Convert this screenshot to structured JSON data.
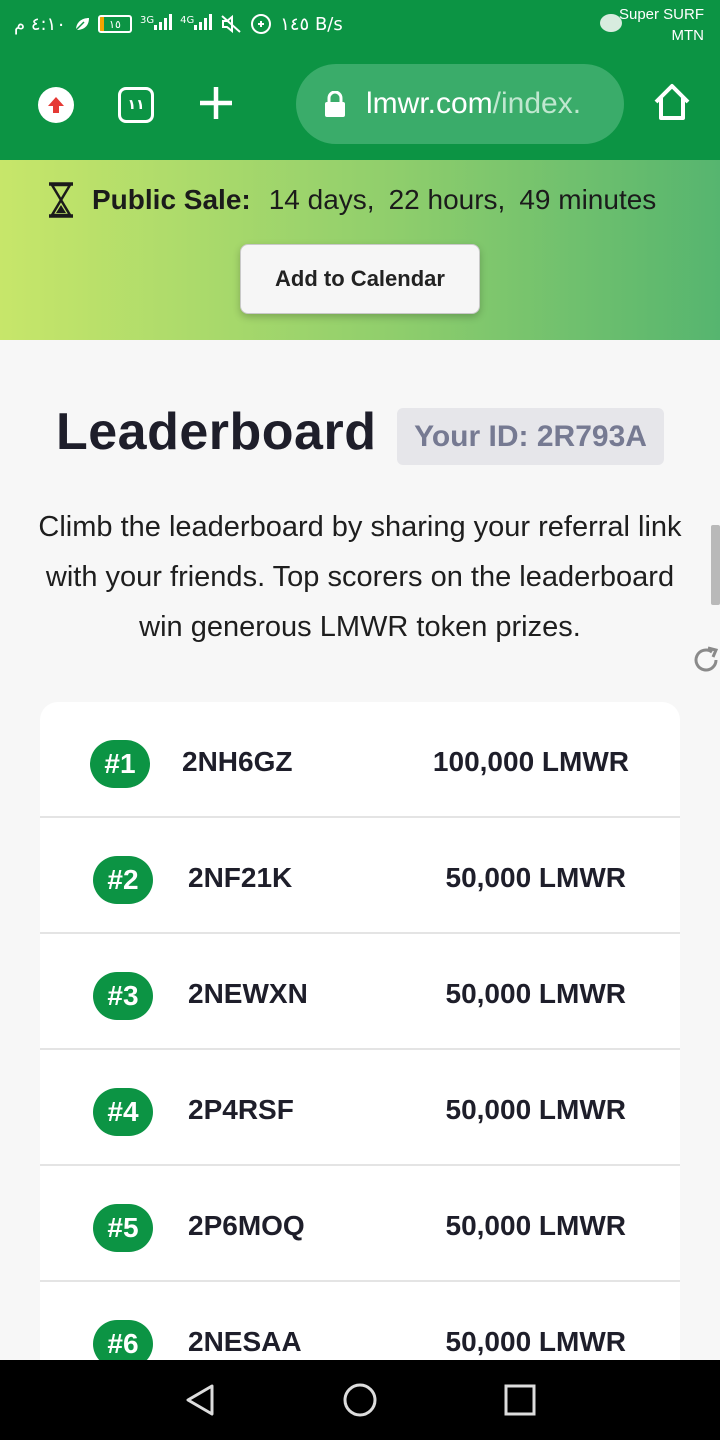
{
  "status_bar": {
    "time": "٤:١٠ م",
    "battery": "١٥",
    "battery_level": 0.15,
    "net1": "3G",
    "net2": "4G",
    "speed": "١٤٥ B/s",
    "carrier_line1": "Super SURF",
    "carrier_line2": "MTN",
    "icons": [
      "leaf-icon",
      "battery-icon",
      "signal-icon",
      "mute-icon",
      "data-saver-icon",
      "chat-icon"
    ]
  },
  "browser": {
    "tab_count": "١١",
    "url_main": "lmwr.com",
    "url_path": "/index.",
    "icons": [
      "upload-icon",
      "tabs-icon",
      "plus-icon",
      "lock-icon",
      "home-icon"
    ]
  },
  "banner": {
    "label": "Public Sale:",
    "days": "14 days,",
    "hours": "22 hours,",
    "minutes": "49 minutes",
    "button": "Add to Calendar"
  },
  "leaderboard": {
    "title": "Leaderboard",
    "your_id": "Your ID: 2R793A",
    "description": "Climb the leaderboard by sharing your referral link with your friends. Top scorers on the leaderboard win generous LMWR token prizes.",
    "rows": [
      {
        "rank": "#1",
        "user": "2NH6GZ",
        "prize": "100,000 LMWR"
      },
      {
        "rank": "#2",
        "user": "2NF21K",
        "prize": "50,000 LMWR"
      },
      {
        "rank": "#3",
        "user": "2NEWXN",
        "prize": "50,000 LMWR"
      },
      {
        "rank": "#4",
        "user": "2P4RSF",
        "prize": "50,000 LMWR"
      },
      {
        "rank": "#5",
        "user": "2P6MOQ",
        "prize": "50,000 LMWR"
      },
      {
        "rank": "#6",
        "user": "2NESAA",
        "prize": "50,000 LMWR"
      }
    ]
  },
  "colors": {
    "brand_green": "#0c9444",
    "banner_start": "#c7e66a",
    "banner_end": "#56b56f",
    "upload_red": "#e53935"
  }
}
